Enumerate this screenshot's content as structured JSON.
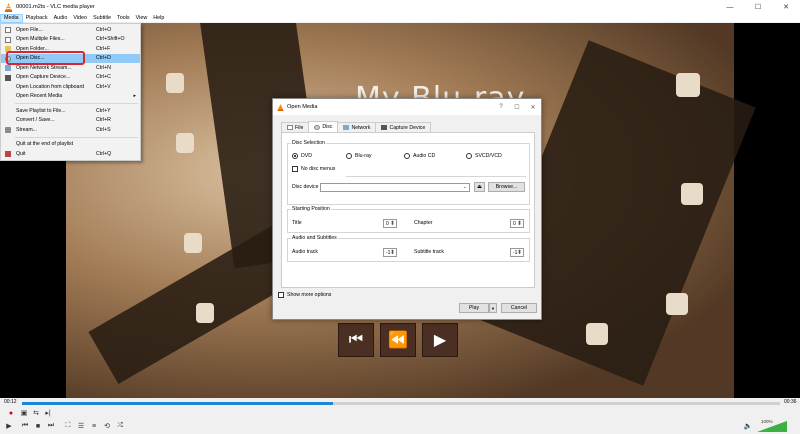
{
  "window": {
    "title": "00001.m2ts - VLC media player"
  },
  "menubar": [
    "Media",
    "Playback",
    "Audio",
    "Video",
    "Subtitle",
    "Tools",
    "View",
    "Help"
  ],
  "media_menu": {
    "items": [
      {
        "label": "Open File...",
        "shortcut": "Ctrl+O"
      },
      {
        "label": "Open Multiple Files...",
        "shortcut": "Ctrl+Shift+O"
      },
      {
        "label": "Open Folder...",
        "shortcut": "Ctrl+F"
      },
      {
        "label": "Open Disc...",
        "shortcut": "Ctrl+D"
      },
      {
        "label": "Open Network Stream...",
        "shortcut": "Ctrl+N"
      },
      {
        "label": "Open Capture Device...",
        "shortcut": "Ctrl+C"
      },
      {
        "label": "Open Location from clipboard",
        "shortcut": "Ctrl+V"
      },
      {
        "label": "Open Recent Media",
        "shortcut": ""
      },
      {
        "label": "Save Playlist to File...",
        "shortcut": "Ctrl+Y"
      },
      {
        "label": "Convert / Save...",
        "shortcut": "Ctrl+R"
      },
      {
        "label": "Stream...",
        "shortcut": "Ctrl+S"
      },
      {
        "label": "Quit at the end of playlist",
        "shortcut": ""
      },
      {
        "label": "Quit",
        "shortcut": "Ctrl+Q"
      }
    ]
  },
  "video": {
    "overlay_text": "My Blu-ray"
  },
  "dialog": {
    "title": "Open Media",
    "tabs": [
      "File",
      "Disc",
      "Network",
      "Capture Device"
    ],
    "disc_selection": {
      "label": "Disc Selection",
      "options": [
        "DVD",
        "Blu-ray",
        "Audio CD",
        "SVCD/VCD"
      ],
      "no_menus": "No disc menus",
      "device_label": "Disc device",
      "browse": "Browse..."
    },
    "starting_position": {
      "label": "Starting Position",
      "title_label": "Title",
      "title_value": "0",
      "chapter_label": "Chapter",
      "chapter_value": "0"
    },
    "audio_subs": {
      "label": "Audio and Subtitles",
      "audio_label": "Audio track",
      "audio_value": "-1",
      "subtitle_label": "Subtitle track",
      "subtitle_value": "-1"
    },
    "show_more": "Show more options",
    "play": "Play",
    "cancel": "Cancel"
  },
  "playback": {
    "elapsed": "00:12",
    "total": "00:36",
    "progress": 0.41,
    "volume": "100%"
  }
}
